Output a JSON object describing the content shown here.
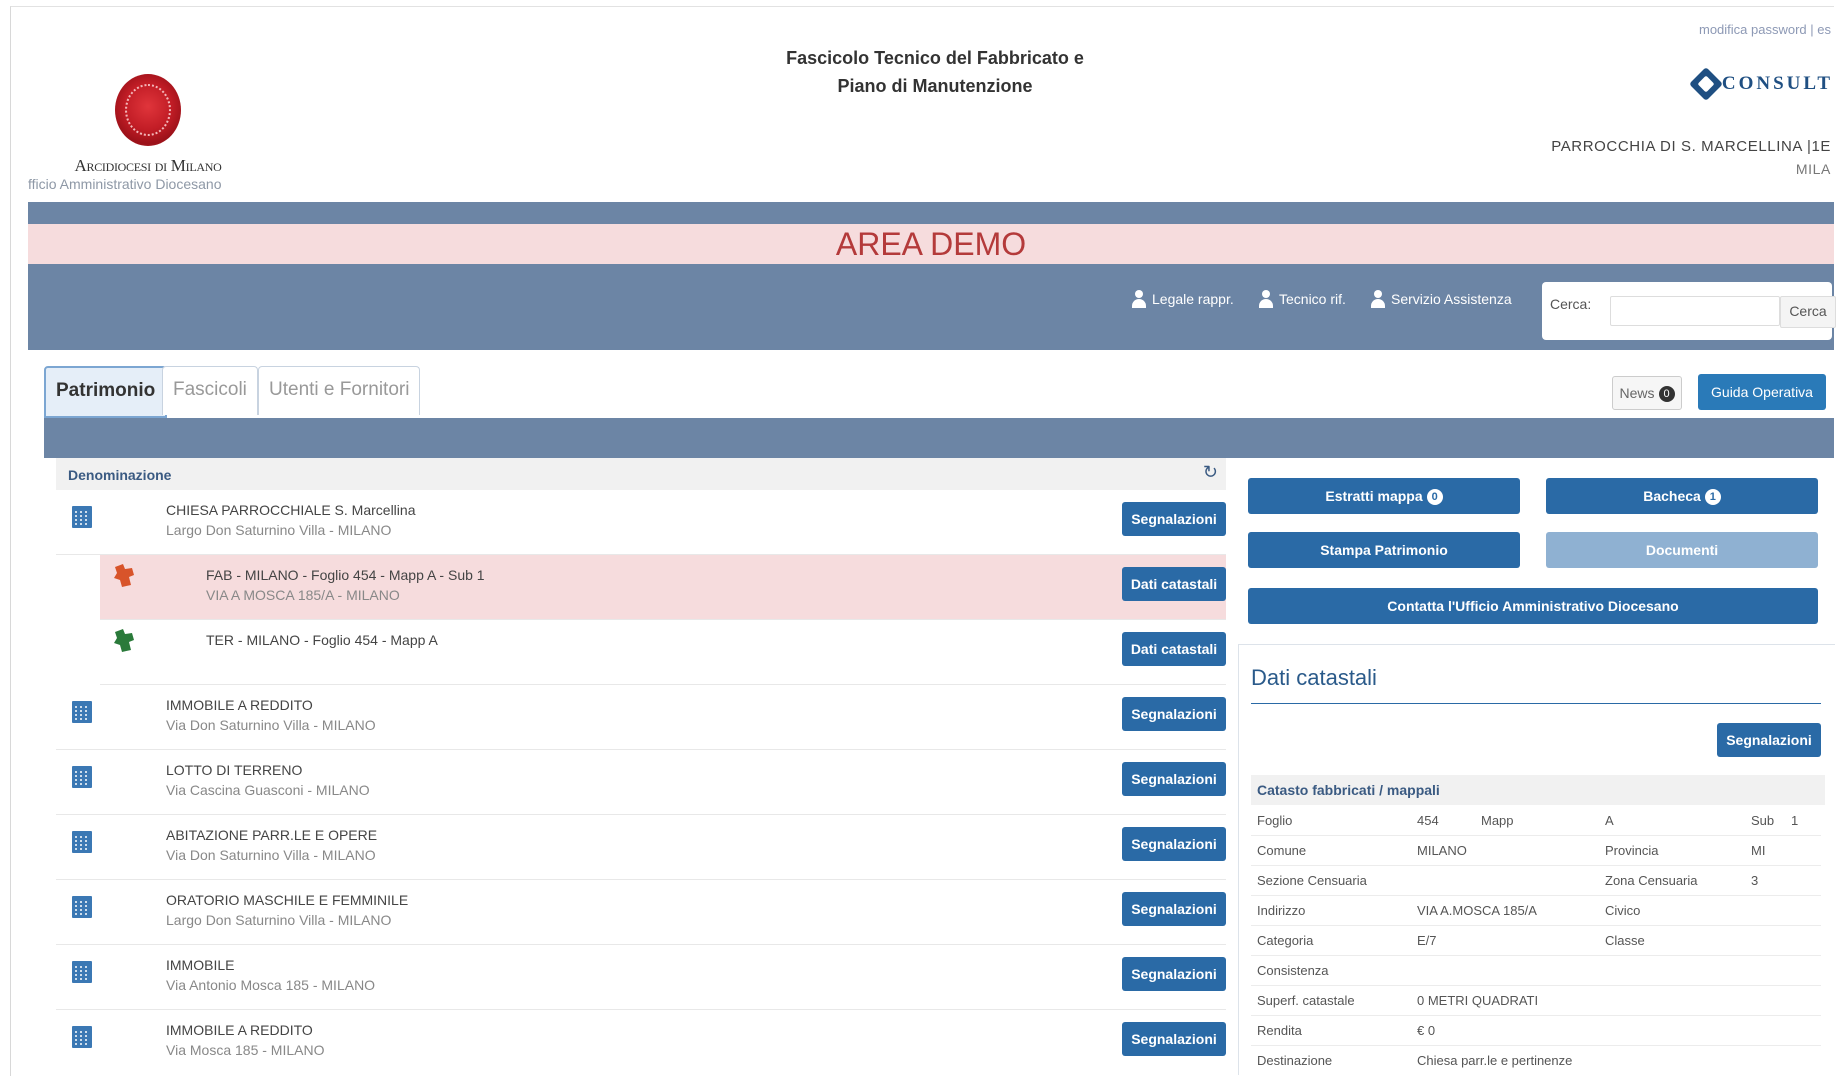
{
  "header": {
    "title_line1": "Fascicolo Tecnico del Fabbricato e",
    "title_line2": "Piano di Manutenzione",
    "org_name": "Arcidiocesi di Milano",
    "org_office": "fficio Amministrativo Diocesano",
    "top_links": "modifica password | es",
    "brand": "CONSULT",
    "parish_name": "PARROCCHIA DI S. MARCELLINA |1E",
    "parish_city": "MILA"
  },
  "banner": {
    "text": "AREA DEMO"
  },
  "nav": {
    "links": [
      "Legale rappr.",
      "Tecnico rif.",
      "Servizio Assistenza"
    ],
    "search_label": "Cerca:",
    "search_value": "",
    "search_button": "Cerca"
  },
  "tabs": [
    "Patrimonio",
    "Fascicoli",
    "Utenti e Fornitori"
  ],
  "toolbar": {
    "news_label": "News",
    "news_count": "0",
    "guide_label": "Guida Operativa"
  },
  "list": {
    "header": "Denominazione",
    "rows": [
      {
        "title": "CHIESA PARROCCHIALE S. Marcellina",
        "sub": "Largo Don Saturnino Villa - MILANO",
        "button": "Segnalazioni"
      },
      {
        "title": "FAB - MILANO - Foglio 454 - Mapp A - Sub 1",
        "sub": "VIA A MOSCA 185/A - MILANO",
        "button": "Dati catastali"
      },
      {
        "title": "TER - MILANO - Foglio 454 - Mapp A",
        "sub": "",
        "button": "Dati catastali"
      },
      {
        "title": "IMMOBILE A REDDITO",
        "sub": "Via Don Saturnino Villa - MILANO",
        "button": "Segnalazioni"
      },
      {
        "title": "LOTTO DI TERRENO",
        "sub": "Via Cascina Guasconi - MILANO",
        "button": "Segnalazioni"
      },
      {
        "title": "ABITAZIONE PARR.LE E OPERE",
        "sub": "Via Don Saturnino Villa - MILANO",
        "button": "Segnalazioni"
      },
      {
        "title": "ORATORIO MASCHILE E FEMMINILE",
        "sub": "Largo Don Saturnino Villa - MILANO",
        "button": "Segnalazioni"
      },
      {
        "title": "IMMOBILE",
        "sub": "Via Antonio Mosca 185 - MILANO",
        "button": "Segnalazioni"
      },
      {
        "title": "IMMOBILE A REDDITO",
        "sub": "Via Mosca 185 - MILANO",
        "button": "Segnalazioni"
      }
    ]
  },
  "actions": {
    "estratti": "Estratti mappa",
    "estratti_count": "0",
    "bacheca": "Bacheca",
    "bacheca_count": "1",
    "stampa": "Stampa Patrimonio",
    "documenti": "Documenti",
    "contatta": "Contatta l'Ufficio Amministrativo Diocesano"
  },
  "detail": {
    "title": "Dati catastali",
    "button": "Segnalazioni",
    "section": "Catasto fabbricati / mappali",
    "rows": [
      {
        "k1": "Foglio",
        "v1": "454",
        "k2": "Mapp",
        "v2": "A",
        "k3": "Sub",
        "v3": "1"
      },
      {
        "k1": "Comune",
        "v1": "MILANO",
        "k2": "Provincia",
        "v2": "MI"
      },
      {
        "k1": "Sezione Censuaria",
        "v1": "",
        "k2": "Zona Censuaria",
        "v2": "3"
      },
      {
        "k1": "Indirizzo",
        "v1": "VIA A.MOSCA 185/A",
        "k2": "Civico",
        "v2": ""
      },
      {
        "k1": "Categoria",
        "v1": "E/7",
        "k2": "Classe",
        "v2": ""
      },
      {
        "k1": "Consistenza",
        "v1": ""
      },
      {
        "k1": "Superf. catastale",
        "v1": "0 METRI QUADRATI"
      },
      {
        "k1": "Rendita",
        "v1": "€ 0"
      },
      {
        "k1": "Destinazione",
        "v1": "Chiesa parr.le e pertinenze"
      }
    ]
  },
  "colors": {
    "bar": "#6c85a5",
    "banner_bg": "#f6dcdd",
    "banner_text": "#b43a3a",
    "button": "#2a6aa6",
    "map_fab": "#d8542a",
    "map_ter": "#2a7a3a"
  }
}
